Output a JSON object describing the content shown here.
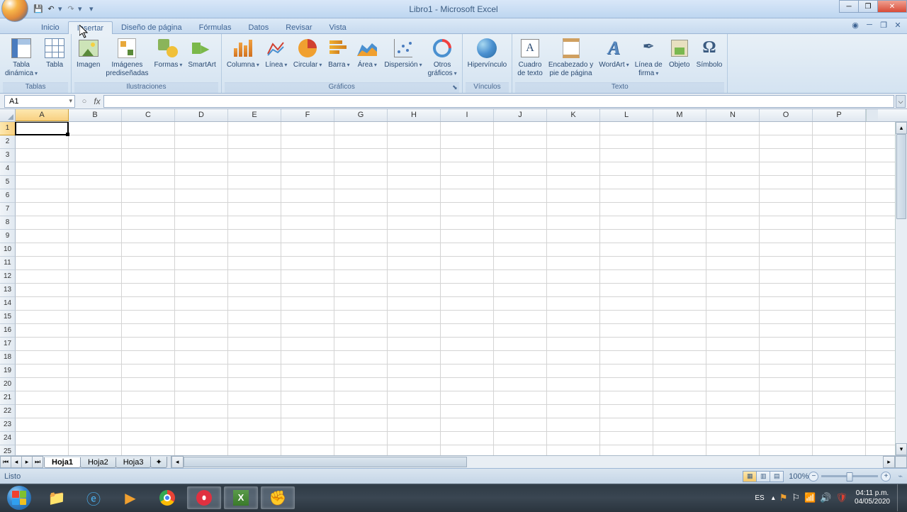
{
  "app_title": "Libro1 - Microsoft Excel",
  "tabs": {
    "inicio": "Inicio",
    "insertar": "Insertar",
    "diseno": "Diseño de página",
    "formulas": "Fórmulas",
    "datos": "Datos",
    "revisar": "Revisar",
    "vista": "Vista"
  },
  "ribbon": {
    "groups": {
      "tablas": "Tablas",
      "ilustraciones": "Ilustraciones",
      "graficos": "Gráficos",
      "vinculos": "Vínculos",
      "texto": "Texto"
    },
    "btns": {
      "tabla_dinamica": "Tabla\ndinámica",
      "tabla": "Tabla",
      "imagen": "Imagen",
      "imagenes_pred": "Imágenes\nprediseñadas",
      "formas": "Formas",
      "smartart": "SmartArt",
      "columna": "Columna",
      "linea": "Línea",
      "circular": "Circular",
      "barra": "Barra",
      "area": "Área",
      "dispersion": "Dispersión",
      "otros": "Otros\ngráficos",
      "hipervinculo": "Hipervínculo",
      "cuadro_texto": "Cuadro\nde texto",
      "encabezado": "Encabezado y\npie de página",
      "wordart": "WordArt",
      "linea_firma": "Línea de\nfirma",
      "objeto": "Objeto",
      "simbolo": "Símbolo"
    }
  },
  "namebox": "A1",
  "fx_label": "fx",
  "columns": [
    "A",
    "B",
    "C",
    "D",
    "E",
    "F",
    "G",
    "H",
    "I",
    "J",
    "K",
    "L",
    "M",
    "N",
    "O",
    "P"
  ],
  "rows": [
    "1",
    "2",
    "3",
    "4",
    "5",
    "6",
    "7",
    "8",
    "9",
    "10",
    "11",
    "12",
    "13",
    "14",
    "15",
    "16",
    "17",
    "18",
    "19",
    "20",
    "21",
    "22",
    "23",
    "24",
    "25"
  ],
  "sheets": {
    "hoja1": "Hoja1",
    "hoja2": "Hoja2",
    "hoja3": "Hoja3"
  },
  "status": {
    "ready": "Listo",
    "zoom": "100%"
  },
  "taskbar": {
    "lang": "ES",
    "time": "04:11 p.m.",
    "date": "04/05/2020"
  }
}
